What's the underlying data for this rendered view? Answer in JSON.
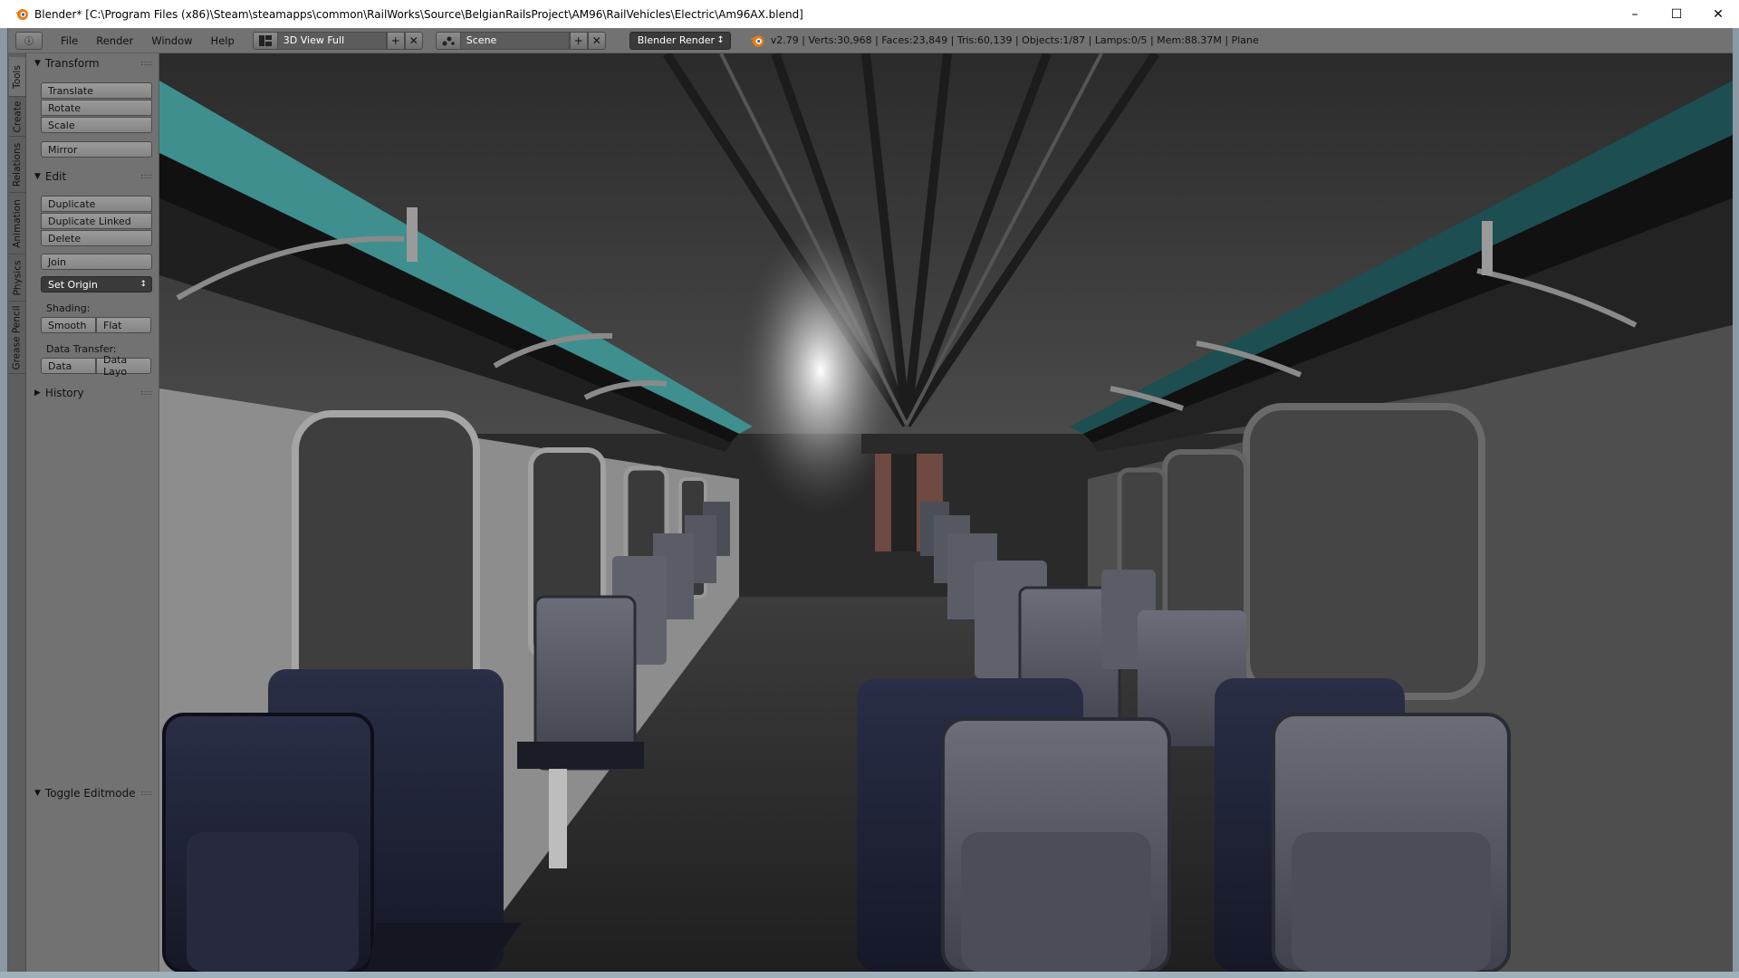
{
  "window": {
    "title": "Blender* [C:\\Program Files (x86)\\Steam\\steamapps\\common\\RailWorks\\Source\\BelgianRailsProject\\AM96\\RailVehicles\\Electric\\Am96AX.blend]",
    "minimize": "–",
    "maximize": "☐",
    "close": "✕",
    "icons": {
      "app": "blender-app-icon"
    }
  },
  "infobar": {
    "editor_icon": "ⓘ",
    "menus": [
      "File",
      "Render",
      "Window",
      "Help"
    ],
    "screen_layout": "3D View Full",
    "scene": "Scene",
    "add_glyph": "+",
    "close_glyph": "✕",
    "renderer": "Blender Render",
    "updown_glyph": "↕",
    "stats": "v2.79 | Verts:30,968 | Faces:23,849 | Tris:60,139 | Objects:1/87 | Lamps:0/5 | Mem:88.37M | Plane"
  },
  "tabs": [
    "Tools",
    "Create",
    "Relations",
    "Animation",
    "Physics",
    "Grease Pencil"
  ],
  "toolshelf": {
    "transform": {
      "title": "Transform",
      "translate": "Translate",
      "rotate": "Rotate",
      "scale": "Scale",
      "mirror": "Mirror"
    },
    "edit": {
      "title": "Edit",
      "duplicate": "Duplicate",
      "duplicate_linked": "Duplicate Linked",
      "delete": "Delete",
      "join": "Join",
      "set_origin": "Set Origin",
      "shading_label": "Shading:",
      "smooth": "Smooth",
      "flat": "Flat",
      "data_transfer_label": "Data Transfer:",
      "data": "Data",
      "data_layout": "Data Layo"
    },
    "history": {
      "title": "History"
    },
    "operator": {
      "title": "Toggle Editmode"
    },
    "expanded_glyph": "▼",
    "collapsed_glyph": "▶"
  },
  "colors": {
    "accent_teal": "#3f8f8f",
    "seat_blue": "#1f2236",
    "seat_grey": "#5a5d66",
    "header_grey": "#727272"
  }
}
